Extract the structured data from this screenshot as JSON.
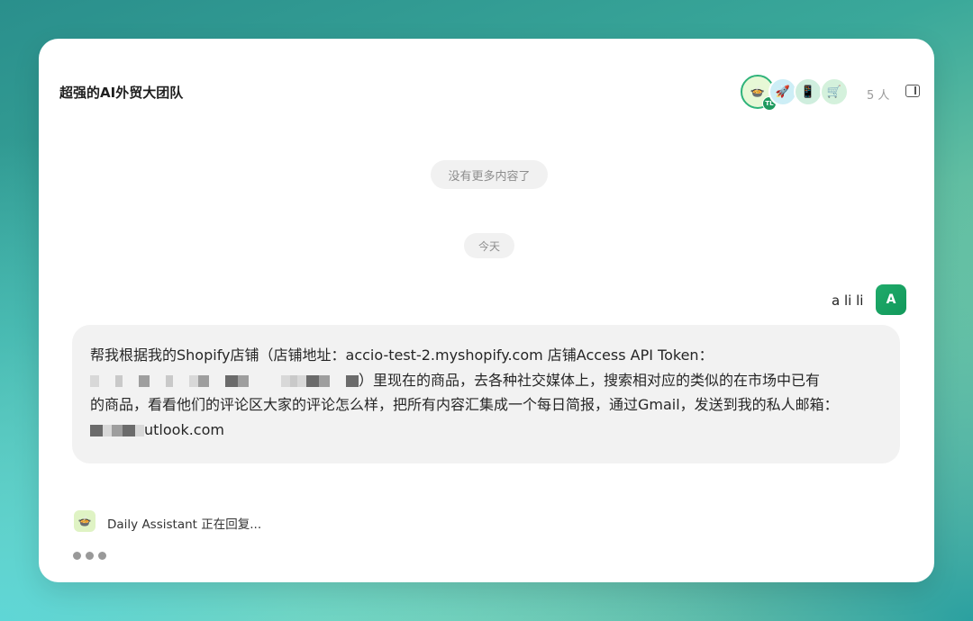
{
  "header": {
    "title": "超强的AI外贸大团队",
    "members": [
      {
        "icon": "robot-bowl-icon",
        "glyph": "🍲",
        "badge": "TL"
      },
      {
        "icon": "rocket-icon",
        "glyph": "🚀"
      },
      {
        "icon": "tablet-icon",
        "glyph": "📱"
      },
      {
        "icon": "cart-icon",
        "glyph": "🛒"
      }
    ],
    "member_count": "5 人"
  },
  "system": {
    "no_more": "没有更多内容了",
    "today": "今天"
  },
  "user": {
    "name": "a li li",
    "avatar_letter": "A"
  },
  "message": {
    "line1": "帮我根据我的Shopify店铺（店铺地址：accio-test-2.myshopify.com 店铺Access API Token：",
    "line2_tail": "）里现在的商品，去各种社交媒体上，搜索相对应的类似的在市场中已有",
    "line3": "的商品，看看他们的评论区大家的评论怎么样，把所有内容汇集成一个每日简报，通过Gmail，发送到我的私人邮箱：",
    "line4_tail": "utlook.com"
  },
  "assistant": {
    "name_status": "Daily Assistant 正在回复...",
    "icon": "bowl-robot-icon"
  },
  "colors": {
    "accent": "#1faa6a",
    "bubble_bg": "#f2f2f2"
  }
}
